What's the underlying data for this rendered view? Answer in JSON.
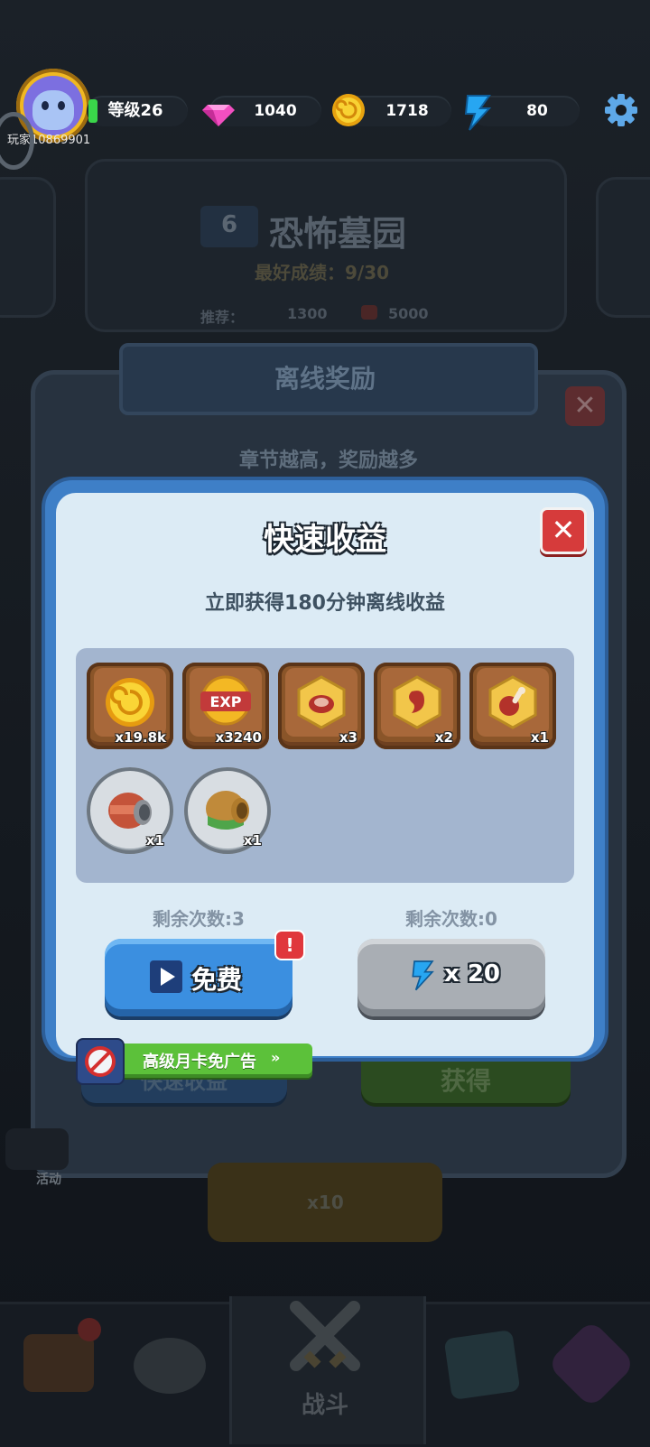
{
  "player": {
    "level_label": "等级26",
    "name": "玩家10869901"
  },
  "currencies": {
    "gems": "1040",
    "coins": "1718",
    "energy": "80"
  },
  "chapter": {
    "number": "6",
    "name": "恐怖墓园",
    "best_record": "最好成绩：9/30",
    "recommend_label": "推荐：",
    "recommend_power": "1300",
    "reward_value": "5000"
  },
  "offline_panel": {
    "title": "离线奖励",
    "subtitle": "章节越高，奖励越多",
    "quick_button": "快速收益",
    "claim_button": "获得",
    "cost": "x10"
  },
  "side": {
    "activity": "活动"
  },
  "dialog": {
    "title": "快速收益",
    "subtitle": "立即获得180分钟离线收益",
    "rewards": [
      {
        "icon": "gold-coin-icon",
        "count": "x19.8k"
      },
      {
        "icon": "exp-badge-icon",
        "count": "x3240"
      },
      {
        "icon": "meat-material-icon",
        "count": "x3"
      },
      {
        "icon": "bean-material-icon",
        "count": "x2"
      },
      {
        "icon": "bone-meat-icon",
        "count": "x1"
      },
      {
        "icon": "red-gauntlet-icon",
        "count": "x1"
      },
      {
        "icon": "green-gauntlet-icon",
        "count": "x1"
      }
    ],
    "free": {
      "remaining": "剩余次数:3",
      "label": "免费"
    },
    "paid": {
      "remaining": "剩余次数:0",
      "label": "x 20"
    },
    "vip_label": "高级月卡免广告"
  },
  "nav": {
    "battle": "战斗"
  },
  "colors": {
    "dialog_blue": "#3e7fc7",
    "free_blue": "#3b8fe0",
    "vip_green": "#5cc13a",
    "close_red": "#d63b3b"
  }
}
